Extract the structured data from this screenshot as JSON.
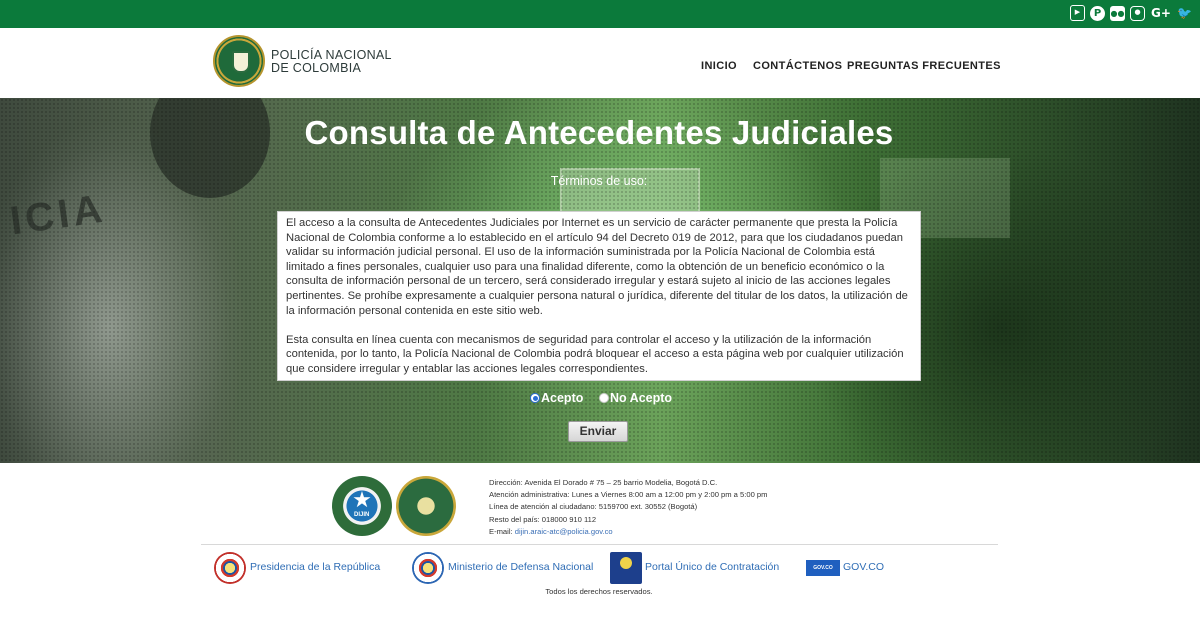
{
  "social": {
    "icons": [
      {
        "name": "youtube-icon",
        "glyph": "You\nTube"
      },
      {
        "name": "pinterest-icon",
        "glyph": "P"
      },
      {
        "name": "flickr-icon",
        "glyph": "●●"
      },
      {
        "name": "instagram-icon",
        "glyph": "◎"
      },
      {
        "name": "google-plus-icon",
        "glyph": "G+"
      },
      {
        "name": "twitter-icon",
        "glyph": "🐦"
      }
    ]
  },
  "header": {
    "brand_line1": "POLICÍA NACIONAL",
    "brand_line2": "DE COLOMBIA",
    "nav": {
      "home": "INICIO",
      "contact": "CONTÁCTENOS",
      "faq": "PREGUNTAS FRECUENTES"
    }
  },
  "hero": {
    "title": "Consulta de Antecedentes Judiciales",
    "terms_label": "Términos de uso:",
    "terms_paragraph_1": "El acceso a la consulta de Antecedentes Judiciales por Internet es un servicio de carácter permanente que presta la Policía Nacional de Colombia conforme a lo establecido en el artículo 94 del Decreto 019 de 2012, para que los ciudadanos puedan validar su información judicial personal. El uso de la información suministrada por la Policía Nacional de Colombia está limitado a fines personales, cualquier uso para una finalidad diferente, como la obtención de un beneficio económico o la consulta de información personal de un tercero, será considerado irregular y estará sujeto al inicio de las acciones legales pertinentes. Se prohíbe expresamente a cualquier persona natural o jurídica, diferente del titular de los datos, la utilización de la información personal contenida en este sitio web.",
    "terms_paragraph_2": "Esta consulta en línea cuenta con mecanismos de seguridad para controlar el acceso y la utilización de la información contenida, por lo tanto, la Policía Nacional de Colombia podrá bloquear el acceso a esta página web por cualquier utilización que considere irregular y entablar las acciones legales correspondientes.",
    "accept_label": "Acepto",
    "decline_label": "No Acepto",
    "selected_option": "Acepto",
    "submit_label": "Enviar"
  },
  "footer": {
    "dijin_badge_text": "DIJIN",
    "address": "Dirección: Avenida El Dorado # 75 – 25 barrio Modelia, Bogotá D.C.",
    "hours": "Atención administrativa: Lunes a Viernes 8:00 am a 12:00 pm y 2:00 pm a 5:00 pm",
    "phone_line": "Línea de atención al ciudadano: 5159700 ext. 30552 (Bogotá)",
    "rest_of_country": "Resto del país: 018000 910 112",
    "email_label": "E-mail:",
    "email": "dijin.araic-atc@policia.gov.co",
    "links": {
      "presidencia": "Presidencia de la República",
      "ministerio": "Ministerio de Defensa Nacional",
      "portal": "Portal Único de Contratación",
      "govco": "GOV.CO",
      "govco_logo_text": "GOV.CO"
    },
    "rights": "Todos los derechos reservados."
  },
  "colors": {
    "topbar": "#0b7a3b",
    "link": "#2f6db5",
    "radio_selected": "#2a6dd6"
  }
}
